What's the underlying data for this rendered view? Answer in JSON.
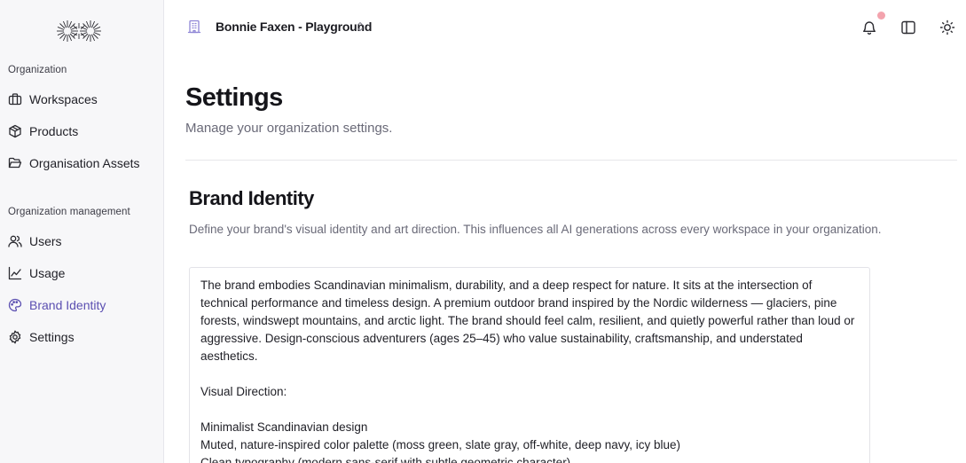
{
  "sidebar": {
    "sections": [
      {
        "label": "Organization",
        "items": [
          {
            "label": "Workspaces",
            "icon": "briefcase-icon"
          },
          {
            "label": "Products",
            "icon": "package-icon"
          },
          {
            "label": "Organisation Assets",
            "icon": "folder-open-icon"
          }
        ]
      },
      {
        "label": "Organization management",
        "items": [
          {
            "label": "Users",
            "icon": "users-icon"
          },
          {
            "label": "Usage",
            "icon": "line-chart-icon"
          },
          {
            "label": "Brand Identity",
            "icon": "palette-icon",
            "active": true
          },
          {
            "label": "Settings",
            "icon": "gear-icon"
          }
        ]
      }
    ]
  },
  "header": {
    "workspace_name": "Bonnie Faxen - Playground"
  },
  "colors": {
    "accent": "#5b4fb1",
    "notification_dot": "#f3a3ad"
  },
  "page": {
    "title": "Settings",
    "subtitle": "Manage your organization settings."
  },
  "brand_identity": {
    "title": "Brand Identity",
    "description": "Define your brand's visual identity and art direction. This influences all AI generations across every workspace in your organization.",
    "value": "The brand embodies Scandinavian minimalism, durability, and a deep respect for nature. It sits at the intersection of technical performance and timeless design. A premium outdoor brand inspired by the Nordic wilderness — glaciers, pine forests, windswept mountains, and arctic light. The brand should feel calm, resilient, and quietly powerful rather than loud or aggressive. Design-conscious adventurers (ages 25–45) who value sustainability, craftsmanship, and understated aesthetics.\n\nVisual Direction:\n\nMinimalist Scandinavian design\nMuted, nature-inspired color palette (moss green, slate gray, off-white, deep navy, icy blue)\nClean typography (modern sans-serif with subtle geometric character)\nGenerous whitespace and balanced layouts"
  }
}
